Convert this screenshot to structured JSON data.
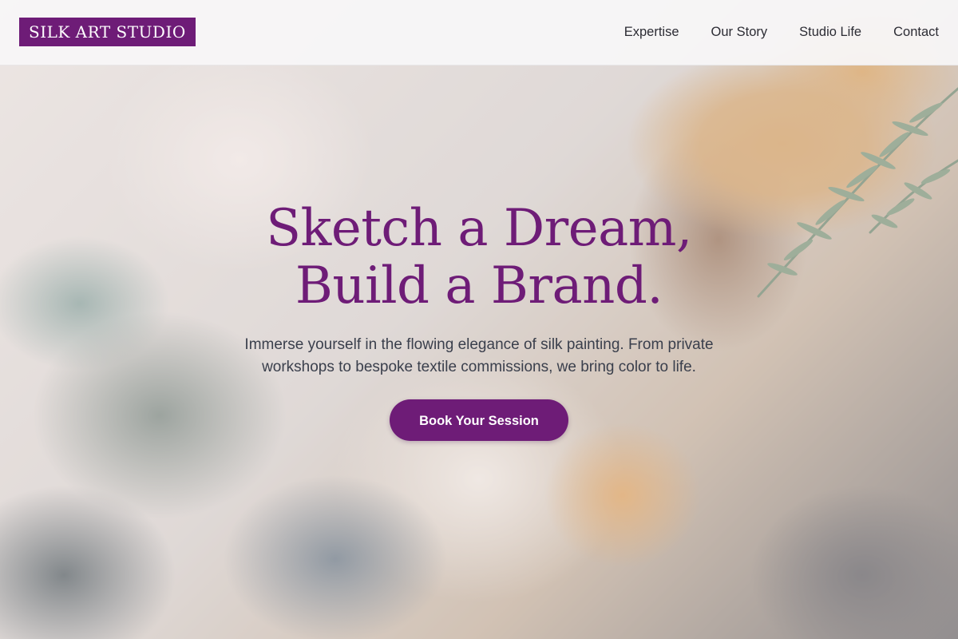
{
  "header": {
    "logo": "SILK ART STUDIO",
    "nav": [
      {
        "label": "Expertise"
      },
      {
        "label": "Our Story"
      },
      {
        "label": "Studio Life"
      },
      {
        "label": "Contact"
      }
    ]
  },
  "hero": {
    "title_line1": "Sketch a Dream,",
    "title_line2": "Build a Brand.",
    "subtitle": "Immerse yourself in the flowing elegance of silk painting. From private workshops to bespoke textile commissions, we bring color to life.",
    "cta_label": "Book Your Session",
    "background": "painted-palette-texture",
    "decoration": "rosemary-sprig-icon"
  },
  "colors": {
    "brand": "#6e1c77",
    "header_bg": "#f7f6f7",
    "text_dark": "#2c2c34",
    "text_body": "#3a3f4c"
  }
}
